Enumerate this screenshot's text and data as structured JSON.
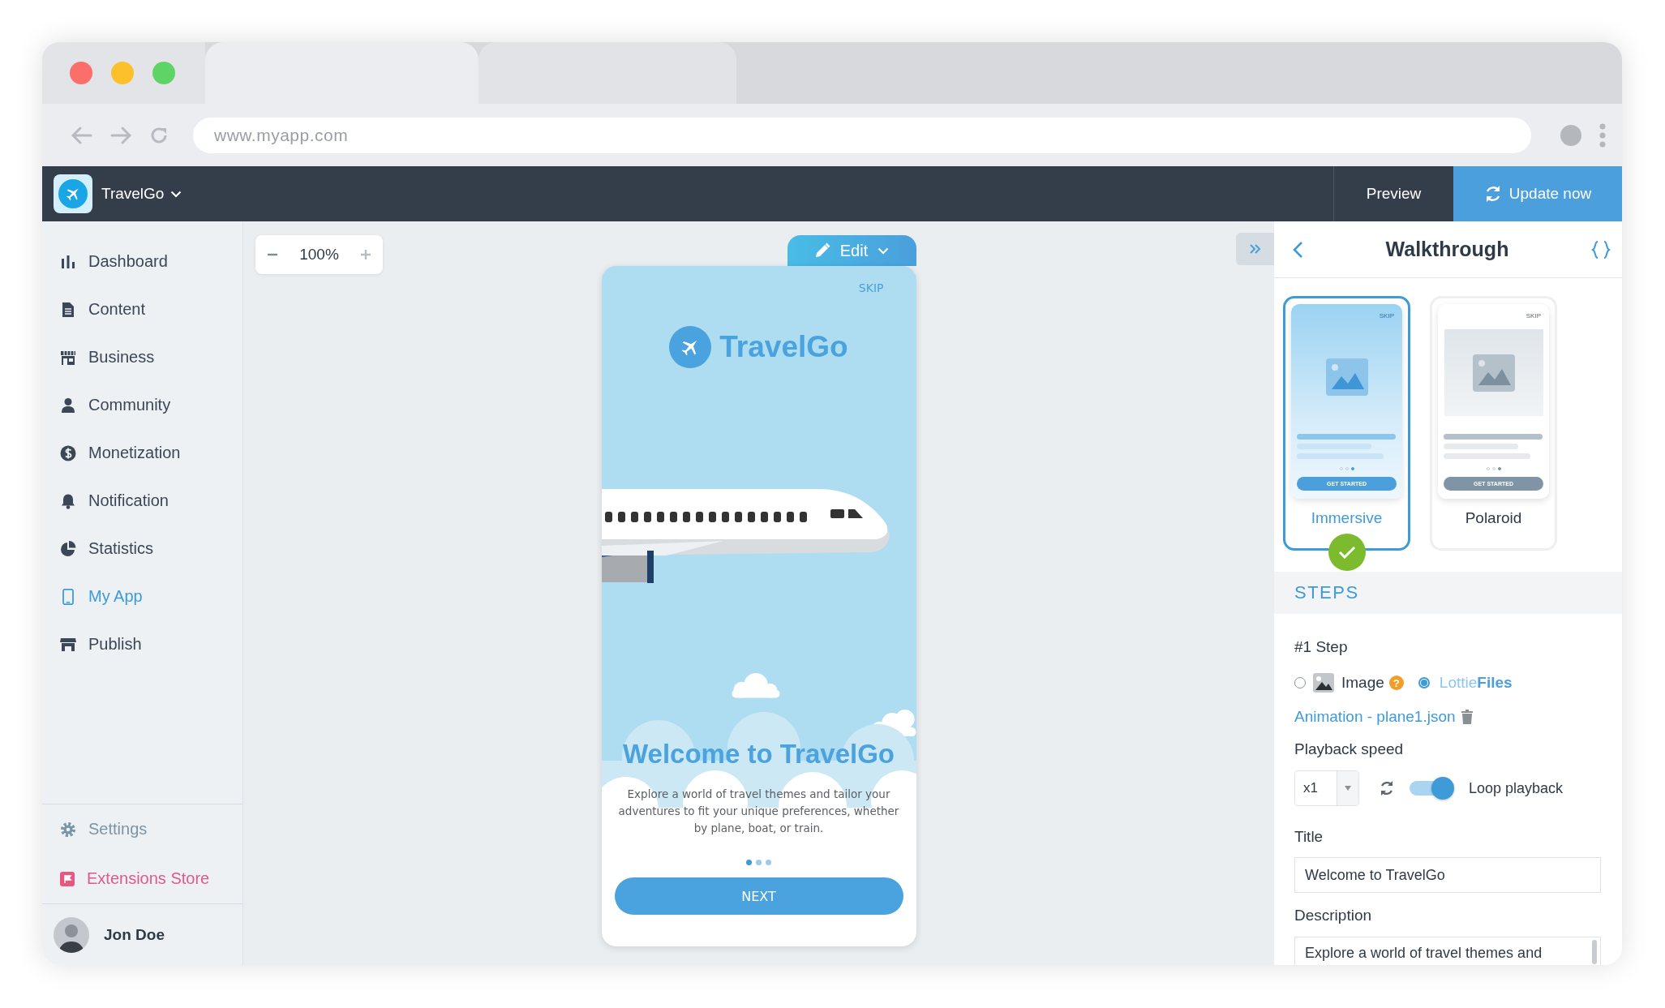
{
  "browser": {
    "url": "www.myapp.com"
  },
  "app": {
    "name": "TravelGo",
    "preview": "Preview",
    "update": "Update now"
  },
  "sidebar": {
    "items": [
      {
        "label": "Dashboard",
        "kind": "chart",
        "selected": false
      },
      {
        "label": "Content",
        "kind": "document",
        "selected": false
      },
      {
        "label": "Business",
        "kind": "building",
        "selected": false
      },
      {
        "label": "Community",
        "kind": "person",
        "selected": false
      },
      {
        "label": "Monetization",
        "kind": "dollar",
        "selected": false
      },
      {
        "label": "Notification",
        "kind": "bell",
        "selected": false
      },
      {
        "label": "Statistics",
        "kind": "pie",
        "selected": false
      },
      {
        "label": "My App",
        "kind": "phone",
        "selected": true
      },
      {
        "label": "Publish",
        "kind": "shop",
        "selected": false
      }
    ],
    "footer": [
      {
        "label": "Settings",
        "kind": "settings"
      },
      {
        "label": "Extensions Store",
        "kind": "extensions"
      }
    ],
    "user": {
      "name": "Jon Doe"
    }
  },
  "canvas": {
    "zoom": "100%",
    "edit": "Edit"
  },
  "phone": {
    "skip": "SKIP",
    "brand": "TravelGo",
    "title": "Welcome to TravelGo",
    "description": "Explore a world of travel themes and tailor your adventures to fit your unique preferences, whether by plane, boat, or train.",
    "pages": [
      {
        "selected": true
      },
      {
        "selected": false
      },
      {
        "selected": false
      }
    ],
    "button": "NEXT"
  },
  "panel": {
    "title": "Walkthrough",
    "layouts": [
      {
        "label": "Immersive",
        "kind": "immersive",
        "selected": true,
        "skip": "SKIP",
        "button": "GET STARTED"
      },
      {
        "label": "Polaroid",
        "kind": "polaroid",
        "selected": false,
        "skip": "SKIP",
        "button": "GET STARTED"
      }
    ],
    "section": "STEPS",
    "step": "#1 Step",
    "sources": [
      {
        "label": "Image",
        "kind": "image",
        "selected": false,
        "help": "?"
      },
      {
        "label": "Lottie**Files**",
        "kind": "lottie",
        "selected": true
      }
    ],
    "file": "Animation - plane1.json",
    "speed_label": "Playback speed",
    "speed": "x1",
    "loop": {
      "label": "Loop playback",
      "on": true
    },
    "title_label": "Title",
    "title_value": "Welcome to TravelGo",
    "description_label": "Description",
    "description_value": "Explore a world of travel themes and"
  }
}
